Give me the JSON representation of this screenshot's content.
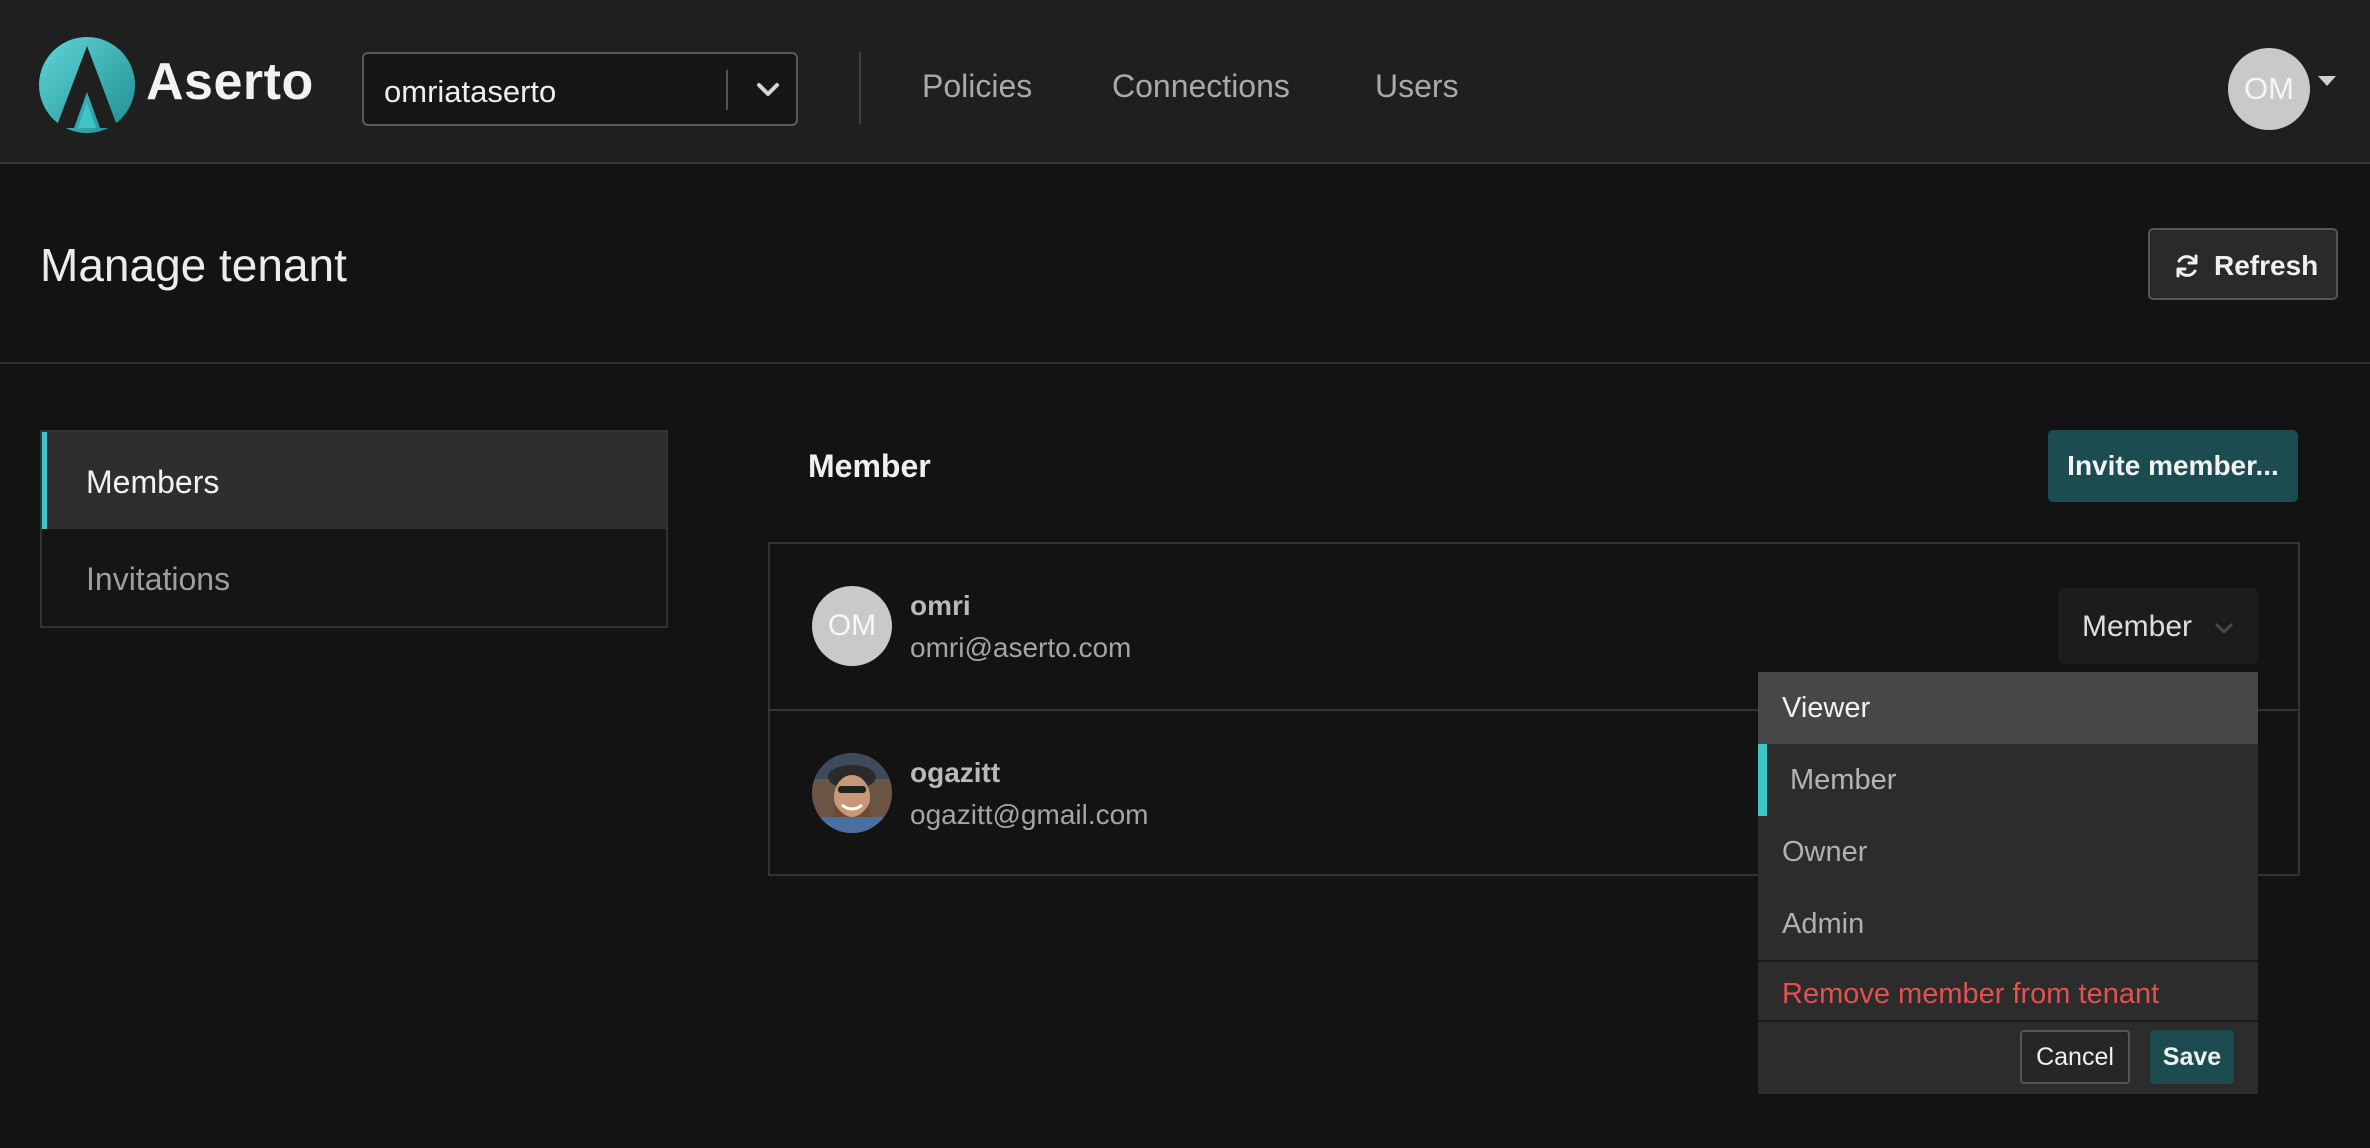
{
  "app": {
    "name": "Aserto",
    "brand_color": "#3fc5c8",
    "accent_dark": "#1d4c50",
    "danger_color": "#e2514f"
  },
  "header": {
    "tenant_select": {
      "value": "omriataserto"
    },
    "nav": [
      {
        "label": "Policies"
      },
      {
        "label": "Connections"
      },
      {
        "label": "Users"
      }
    ],
    "user_avatar": {
      "initials": "OM"
    }
  },
  "page": {
    "title": "Manage tenant",
    "refresh_label": "Refresh"
  },
  "sidebar": {
    "items": [
      {
        "label": "Members",
        "active": true
      },
      {
        "label": "Invitations",
        "active": false
      }
    ]
  },
  "members": {
    "section_title": "Member",
    "invite_label": "Invite member...",
    "rows": [
      {
        "name": "omri",
        "email": "omri@aserto.com",
        "initials": "OM",
        "role": "Member"
      },
      {
        "name": "ogazitt",
        "email": "ogazitt@gmail.com",
        "avatar_icon": "user-photo"
      }
    ]
  },
  "role_dropdown": {
    "options": [
      {
        "label": "Viewer",
        "state": "hover"
      },
      {
        "label": "Member",
        "state": "selected"
      },
      {
        "label": "Owner",
        "state": "none"
      },
      {
        "label": "Admin",
        "state": "none"
      }
    ],
    "remove_label": "Remove member from tenant",
    "cancel_label": "Cancel",
    "save_label": "Save"
  }
}
